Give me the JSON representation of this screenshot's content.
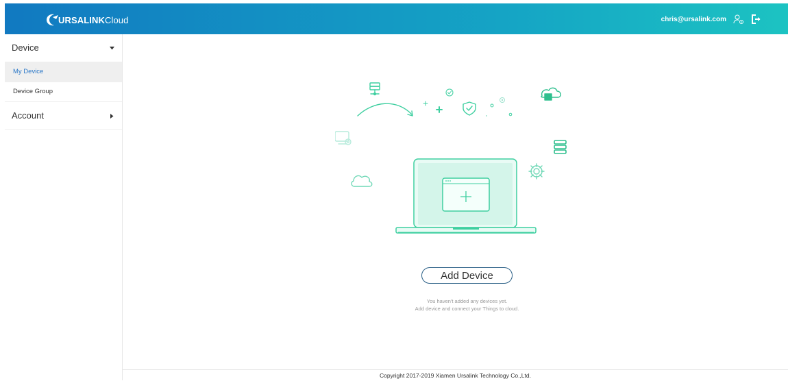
{
  "header": {
    "logo_bold": "URSALINK",
    "logo_light": "Cloud",
    "user_email": "chris@ursalink.com"
  },
  "sidebar": {
    "device_section": "Device",
    "items": [
      {
        "label": "My Device",
        "active": true
      },
      {
        "label": "Device Group",
        "active": false
      }
    ],
    "account_section": "Account"
  },
  "main": {
    "add_device_label": "Add Device",
    "hint_line1": "You haven't added any devices yet.",
    "hint_line2": "Add device and connect your Things to cloud."
  },
  "footer": {
    "copyright": "Copyright 2017-2019 Xiamen Ursalink Technology Co.,Ltd."
  },
  "colors": {
    "header_start": "#1179c1",
    "header_end": "#1cc3c2",
    "accent_green": "#3ecfa0",
    "active_text": "#2a77c7"
  },
  "icons": [
    "logo-icon",
    "user-settings-icon",
    "logout-icon",
    "caret-down-icon",
    "caret-right-icon"
  ]
}
